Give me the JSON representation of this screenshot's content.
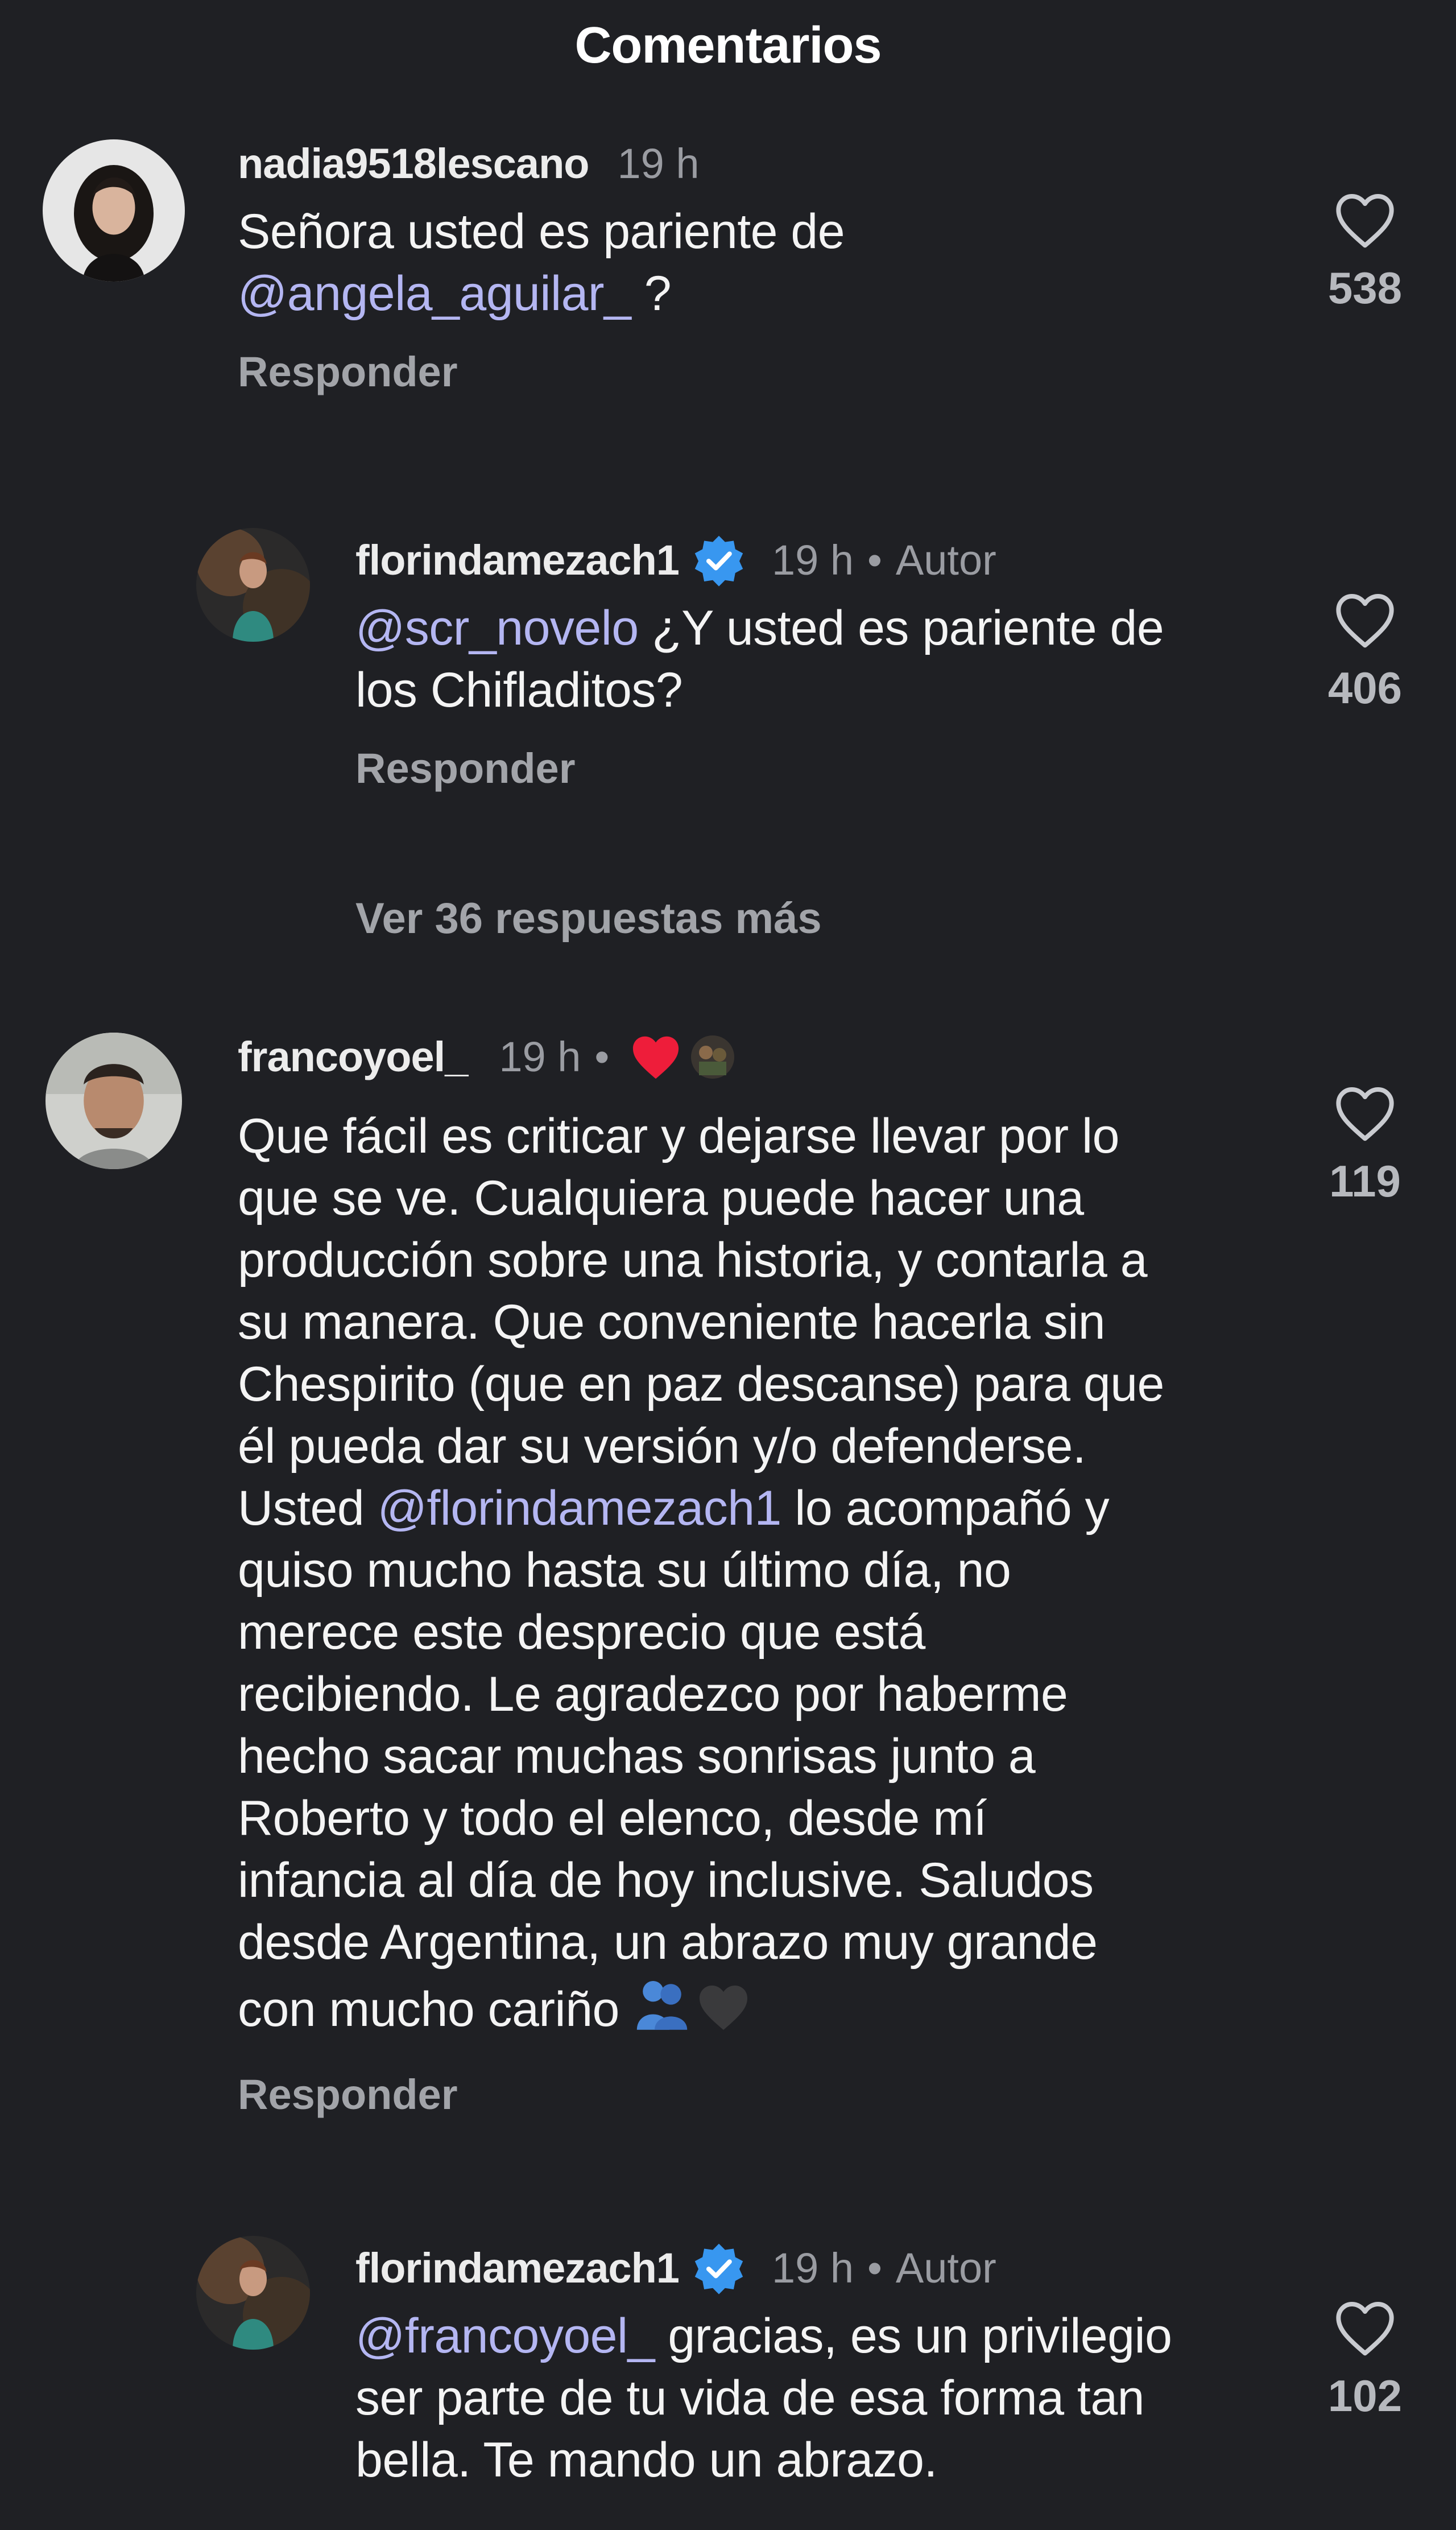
{
  "header": {
    "title": "Comentarios"
  },
  "comments": [
    {
      "username": "nadia9518lescano",
      "time": "19 h",
      "text_before": "Señora usted es pariente de\n",
      "mention": "@angela_aguilar_",
      "text_after": " ?",
      "reply_label": "Responder",
      "likes": "538"
    },
    {
      "username": "florindamezach1",
      "time": "19 h",
      "dot": "•",
      "author_label": "Autor",
      "mention": "@scr_novelo",
      "text_after": " ¿Y usted es pariente de\nlos Chifladitos?",
      "reply_label": "Responder",
      "likes": "406"
    },
    {
      "username": "francoyoel_",
      "time": "19 h",
      "dot": "•",
      "text_before": "Que fácil es criticar y dejarse llevar por lo\nque se ve. Cualquiera puede hacer una\nproducción sobre una historia, y contarla a\nsu manera. Que conveniente hacerla sin\nChespirito (que en paz descanse) para que\nél pueda dar su versión y/o defenderse.\nUsted ",
      "mention": "@florindamezach1",
      "text_after": "  lo acompañó y\nquiso mucho hasta su último día, no\nmerece este desprecio que está\nrecibiendo. Le agradezco por haberme\nhecho sacar muchas sonrisas junto a\nRoberto y todo el elenco, desde mí\ninfancia al día de hoy inclusive. Saludos\ndesde Argentina, un abrazo muy grande\ncon mucho cariño ",
      "reply_label": "Responder",
      "likes": "119"
    },
    {
      "username": "florindamezach1",
      "time": "19 h",
      "dot": "•",
      "author_label": "Autor",
      "mention": "@francoyoel_",
      "text_after": " gracias, es un privilegio\nser parte de tu vida de esa forma tan\nbella. Te mando un abrazo.",
      "likes": "102"
    }
  ],
  "more_replies": "Ver 36 respuestas más",
  "colors": {
    "background": "#1f2024",
    "mention": "#b4b6f2",
    "verified": "#3897f0",
    "heart_reaction": "#ee1d3a"
  },
  "icons": [
    "heart-outline-icon",
    "verified-badge-icon",
    "red-heart-emoji-icon",
    "hugging-people-emoji-icon",
    "black-heart-emoji-icon"
  ]
}
